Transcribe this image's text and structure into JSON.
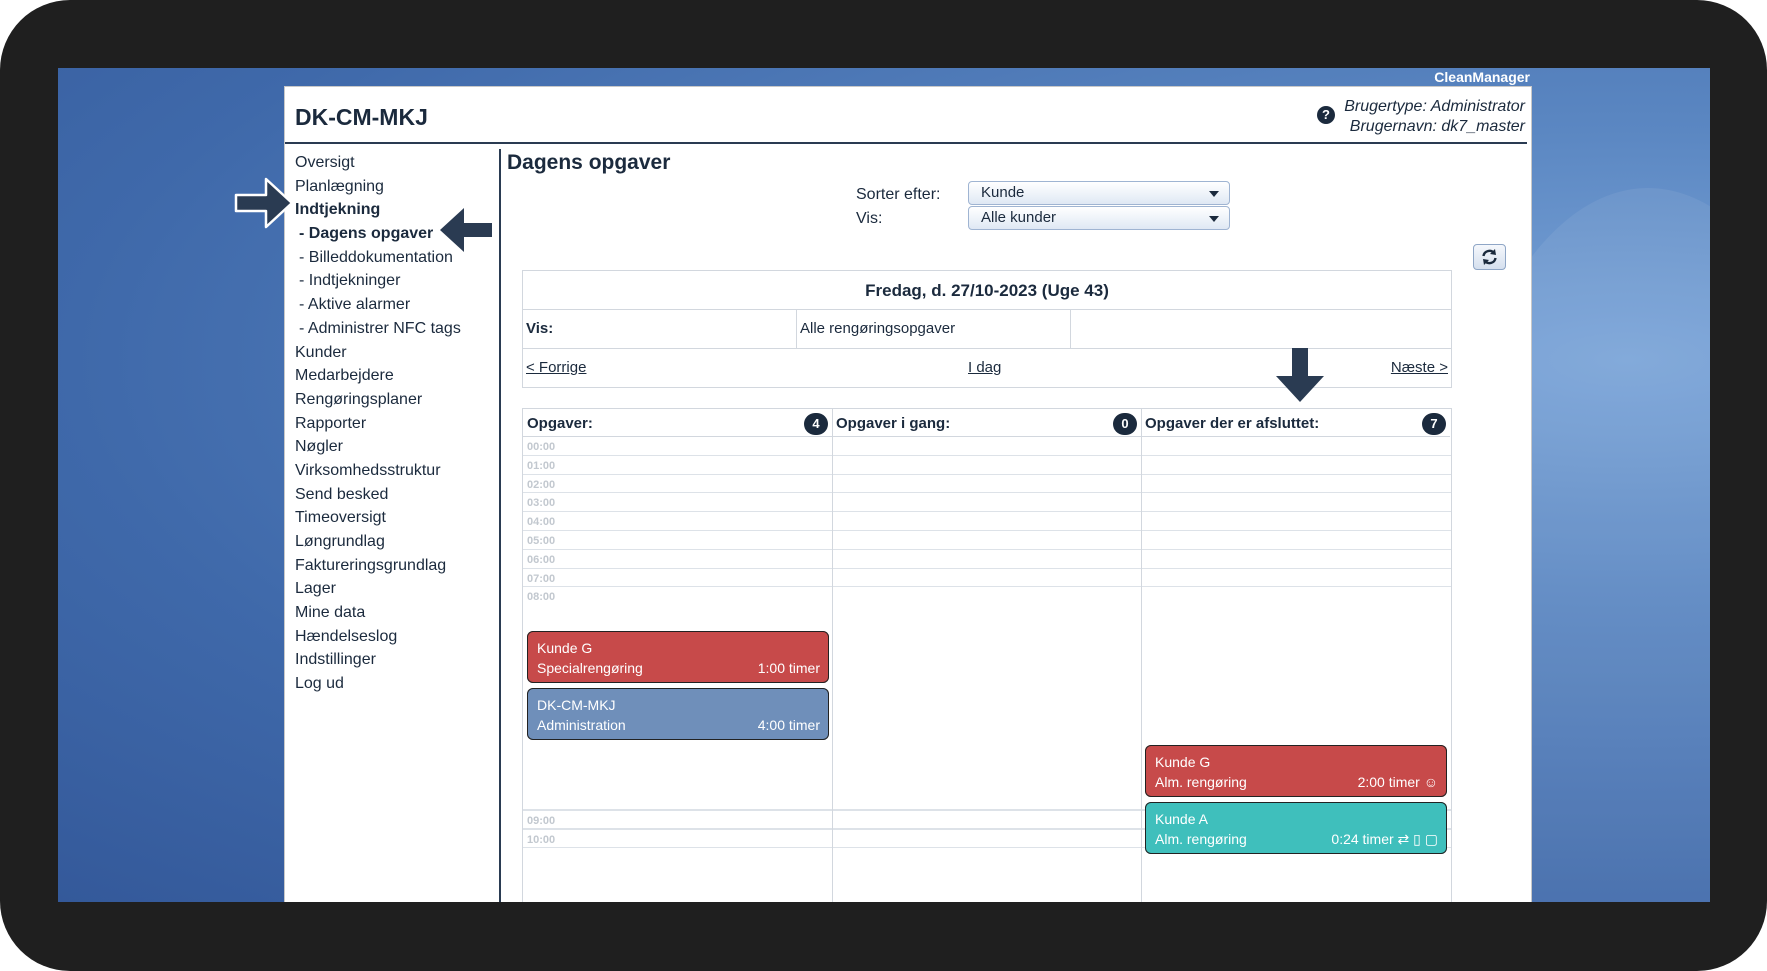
{
  "brand": "CleanManager",
  "app_title": "DK-CM-MKJ",
  "user": {
    "type_label": "Brugertype: Administrator",
    "name_label": "Brugernavn: dk7_master",
    "help_icon": "question-circle-icon"
  },
  "sidebar": {
    "items": [
      {
        "label": "Oversigt"
      },
      {
        "label": "Planlægning"
      },
      {
        "label": "Indtjekning"
      },
      {
        "label": "- Dagens opgaver"
      },
      {
        "label": "- Billeddokumentation"
      },
      {
        "label": "- Indtjekninger"
      },
      {
        "label": "- Aktive alarmer"
      },
      {
        "label": "- Administrer NFC tags"
      },
      {
        "label": "Kunder"
      },
      {
        "label": "Medarbejdere"
      },
      {
        "label": "Rengøringsplaner"
      },
      {
        "label": "Rapporter"
      },
      {
        "label": "Nøgler"
      },
      {
        "label": "Virksomhedsstruktur"
      },
      {
        "label": "Send besked"
      },
      {
        "label": "Timeoversigt"
      },
      {
        "label": "Løngrundlag"
      },
      {
        "label": "Faktureringsgrundlag"
      },
      {
        "label": "Lager"
      },
      {
        "label": "Mine data"
      },
      {
        "label": "Hændelseslog"
      },
      {
        "label": "Indstillinger"
      },
      {
        "label": "Log ud"
      }
    ]
  },
  "main": {
    "title": "Dagens opgaver",
    "sort_label": "Sorter efter:",
    "sort_value": "Kunde",
    "show_label": "Vis:",
    "show_value": "Alle kunder",
    "refresh_icon": "refresh-icon",
    "date_heading": "Fredag, d. 27/10-2023 (Uge 43)",
    "vis_label": "Vis:",
    "vis_value": "Alle rengøringsopgaver",
    "prev_link": "< Forrige",
    "today_link": "I dag",
    "next_link": "Næste >",
    "columns": [
      {
        "title": "Opgaver:",
        "count": "4"
      },
      {
        "title": "Opgaver i gang:",
        "count": "0"
      },
      {
        "title": "Opgaver der er afsluttet:",
        "count": "7"
      }
    ],
    "hours_top": [
      "00:00",
      "01:00",
      "02:00",
      "03:00",
      "04:00",
      "05:00",
      "06:00",
      "07:00",
      "08:00"
    ],
    "hours_bottom": [
      "09:00",
      "10:00"
    ],
    "tasks": [
      {
        "customer": "Kunde G",
        "service": "Specialrengøring",
        "duration": "1:00 timer",
        "color": "#c74a4a"
      },
      {
        "customer": "DK-CM-MKJ",
        "service": "Administration",
        "duration": "4:00 timer",
        "color": "#6f8fba"
      },
      {
        "customer": "Kunde G",
        "service": "Alm. rengøring",
        "duration": "2:00 timer ☺",
        "color": "#c74a4a"
      },
      {
        "customer": "Kunde A",
        "service": "Alm. rengøring",
        "duration": "0:24 timer ⇄ ▯ ▢",
        "color": "#3fbfbc"
      }
    ]
  }
}
